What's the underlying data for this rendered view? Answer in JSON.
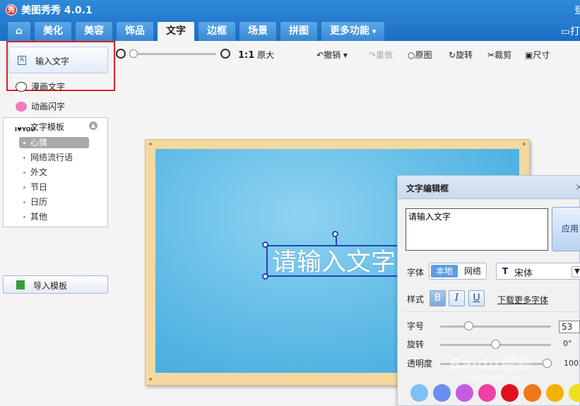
{
  "app": {
    "title": "美图秀秀 4.0.1",
    "logo_text": "秀",
    "title_right": "登",
    "open_label": "打"
  },
  "tabs": [
    {
      "label": "⌂",
      "icon": "home-icon"
    },
    {
      "label": "美化"
    },
    {
      "label": "美容"
    },
    {
      "label": "饰品"
    },
    {
      "label": "文字",
      "active": true
    },
    {
      "label": "边框"
    },
    {
      "label": "场景"
    },
    {
      "label": "拼图"
    },
    {
      "label": "更多功能"
    }
  ],
  "toolbar": {
    "actual_size": "1:1",
    "actual_size_label": "原大",
    "undo": "撤销",
    "redo": "重做",
    "original": "原图",
    "rotate": "旋转",
    "crop": "裁剪",
    "size": "尺寸"
  },
  "left": {
    "input_text": "输入文字",
    "manga_text": "漫画文字",
    "anim_text": "动画闪字",
    "template_title": "文字模板",
    "template_icon_text": "I♥YOU",
    "categories": [
      "心情",
      "网络流行语",
      "外文",
      "节日",
      "日历",
      "其他"
    ],
    "selected_category": "心情",
    "import_label": "导入模板"
  },
  "canvas": {
    "text": "请输入文字"
  },
  "edit_panel": {
    "title": "文字编辑框",
    "close": "×",
    "text_value": "请输入文字",
    "apply_label": "应用",
    "font_label": "字体",
    "font_local": "本地",
    "font_web": "网络",
    "font_icon": "T",
    "font_value": "宋体",
    "style_label": "样式",
    "style_bold": "B",
    "style_italic": "I",
    "style_underline": "U",
    "more_fonts": "下载更多字体",
    "size_label": "字号",
    "size_value": "53",
    "rotate_label": "旋转",
    "rotate_value": "0°",
    "opacity_label": "透明度",
    "opacity_value": "100%",
    "colors": [
      "#7fc1f5",
      "#6a8ff0",
      "#c65be3",
      "#f03fa0",
      "#e0101c",
      "#f07818",
      "#f6b000",
      "#f0e020"
    ]
  },
  "watermark": {
    "main": "Baidu经验",
    "sub": "jingyan.baidu.com"
  }
}
